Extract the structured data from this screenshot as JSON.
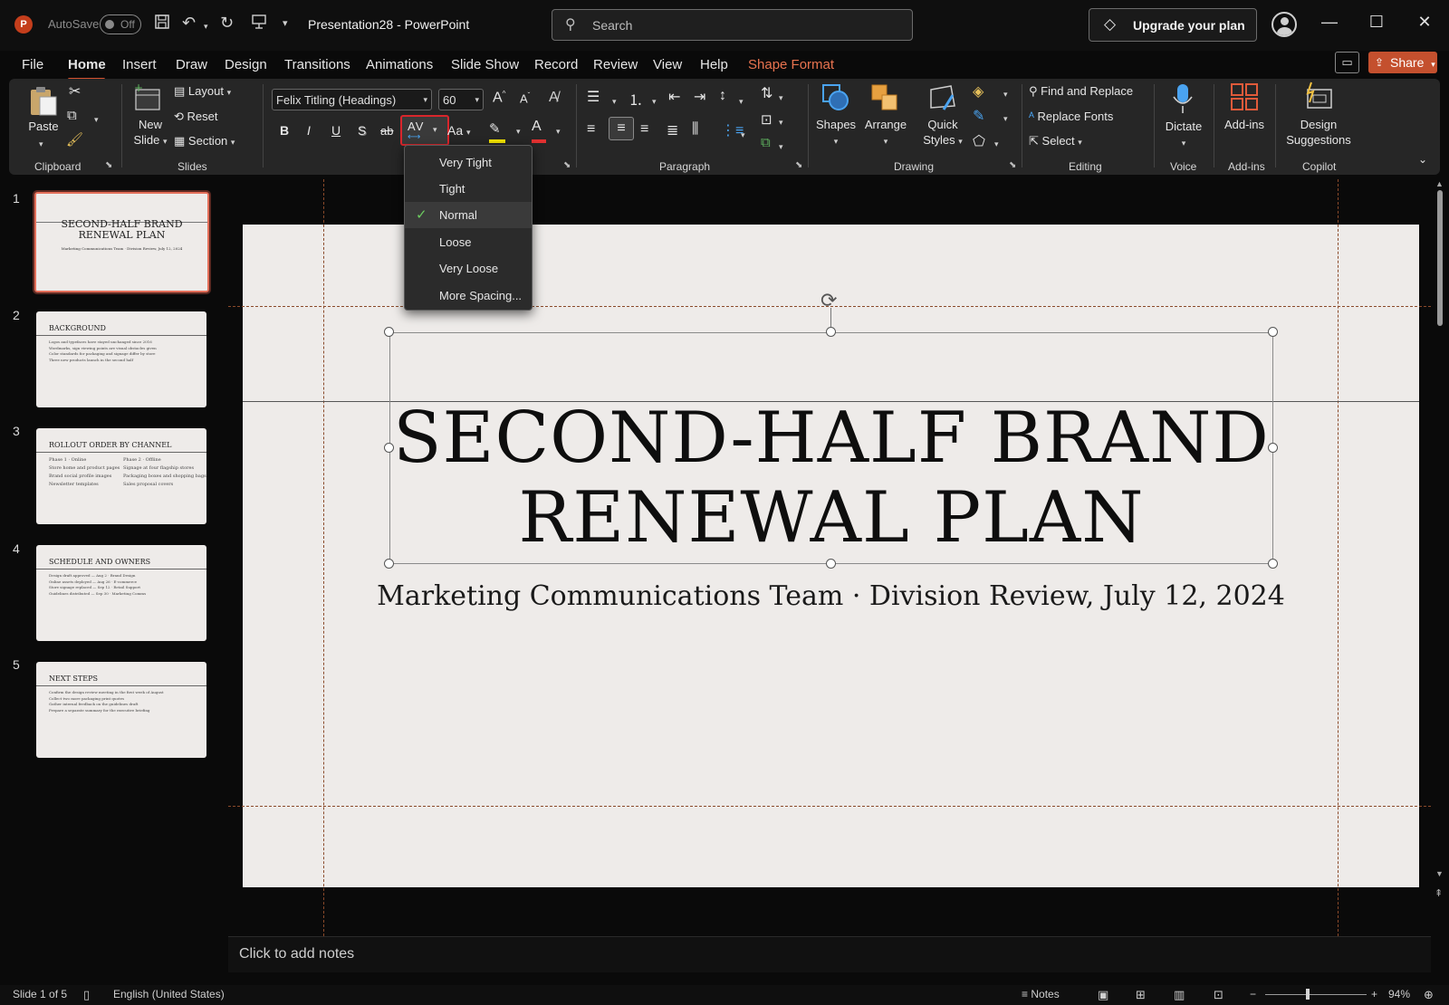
{
  "titlebar": {
    "app_logo": "P",
    "autosave_label": "AutoSave",
    "autosave_state": "Off",
    "doc_title": "Presentation28  -  PowerPoint",
    "search_placeholder": "Search",
    "upgrade_label": "Upgrade your plan",
    "icons": [
      "save-icon",
      "undo-icon",
      "redo-icon",
      "present-icon",
      "customize-qat-icon",
      "diamond-icon",
      "avatar",
      "minimize-icon",
      "maximize-icon",
      "close-icon"
    ]
  },
  "menu_tabs": [
    "File",
    "Home",
    "Insert",
    "Draw",
    "Design",
    "Transitions",
    "Animations",
    "Slide Show",
    "Record",
    "Review",
    "View",
    "Help",
    "Shape Format"
  ],
  "active_tab": "Home",
  "share_label": "Share",
  "ribbon": {
    "clipboard": {
      "paste": "Paste",
      "label": "Clipboard"
    },
    "slides": {
      "new_slide": "New Slide",
      "layout": "Layout",
      "reset": "Reset",
      "section": "Section",
      "label": "Slides"
    },
    "font": {
      "name": "Felix Titling (Headings)",
      "size": "60",
      "spacing_glyph": "AV",
      "case_glyph": "Aa",
      "bold": "B",
      "italic": "I",
      "underline": "U",
      "shadow": "S",
      "strike": "ab",
      "grow": "A",
      "shrink": "A"
    },
    "paragraph": {
      "label": "Paragraph"
    },
    "drawing": {
      "shapes": "Shapes",
      "arrange": "Arrange",
      "quick_styles": "Quick Styles",
      "label": "Drawing"
    },
    "editing": {
      "find_replace": "Find and Replace",
      "replace_fonts": "Replace Fonts",
      "select": "Select",
      "label": "Editing"
    },
    "voice": {
      "dictate": "Dictate",
      "label": "Voice"
    },
    "addins": {
      "addins": "Add-ins",
      "label": "Add-ins"
    },
    "copilot": {
      "design_suggestions": "Design Suggestions",
      "label": "Copilot"
    },
    "colors": {
      "highlight": "#f2e200",
      "font_color": "#e03030",
      "accent": "#d35230"
    }
  },
  "spacing_menu": {
    "items": [
      "Very Tight",
      "Tight",
      "Normal",
      "Loose",
      "Very Loose",
      "More Spacing..."
    ],
    "selected": "Normal"
  },
  "thumbnails": [
    {
      "num": "1",
      "title": "SECOND-HALF BRAND RENEWAL PLAN",
      "sub": "Marketing Communications Team · Division Review, July 12, 2024"
    },
    {
      "num": "2",
      "title": "BACKGROUND",
      "body": [
        "Logos and typefaces have stayed unchanged since 2016",
        "Wordmarks, sign viewing points are visual obstacles given",
        "Color standards for packaging and signage differ by store",
        "Three new products launch in the second half"
      ]
    },
    {
      "num": "3",
      "title": "ROLLOUT ORDER BY CHANNEL",
      "col1": [
        "Phase 1 · Online",
        "Store home and product pages",
        "Brand social profile images",
        "Newsletter templates"
      ],
      "col2": [
        "Phase 2 · Offline",
        "Signage at four flagship stores",
        "Packaging boxes and shopping bags",
        "Sales proposal covers"
      ]
    },
    {
      "num": "4",
      "title": "SCHEDULE AND OWNERS",
      "body": [
        "Design draft approved — Aug 2 · Brand Design",
        "Online assets deployed — Aug 26 · E-commerce",
        "Store signage replaced — Sep 12 · Retail Support",
        "Guidelines distributed — Sep 30 · Marketing Comms"
      ]
    },
    {
      "num": "5",
      "title": "NEXT STEPS",
      "body": [
        "Confirm the design review meeting in the first week of August",
        "Collect two more packaging print quotes",
        "Gather internal feedback on the guidelines draft",
        "Prepare a separate summary for the executive briefing"
      ]
    }
  ],
  "slide": {
    "title": "SECOND-HALF BRAND RENEWAL PLAN",
    "subtitle": "Marketing Communications Team · Division Review, July 12, 2024"
  },
  "notes_placeholder": "Click to add notes",
  "statusbar": {
    "slide_info": "Slide 1 of 5",
    "language": "English (United States)",
    "notes": "Notes",
    "zoom": "94%"
  }
}
